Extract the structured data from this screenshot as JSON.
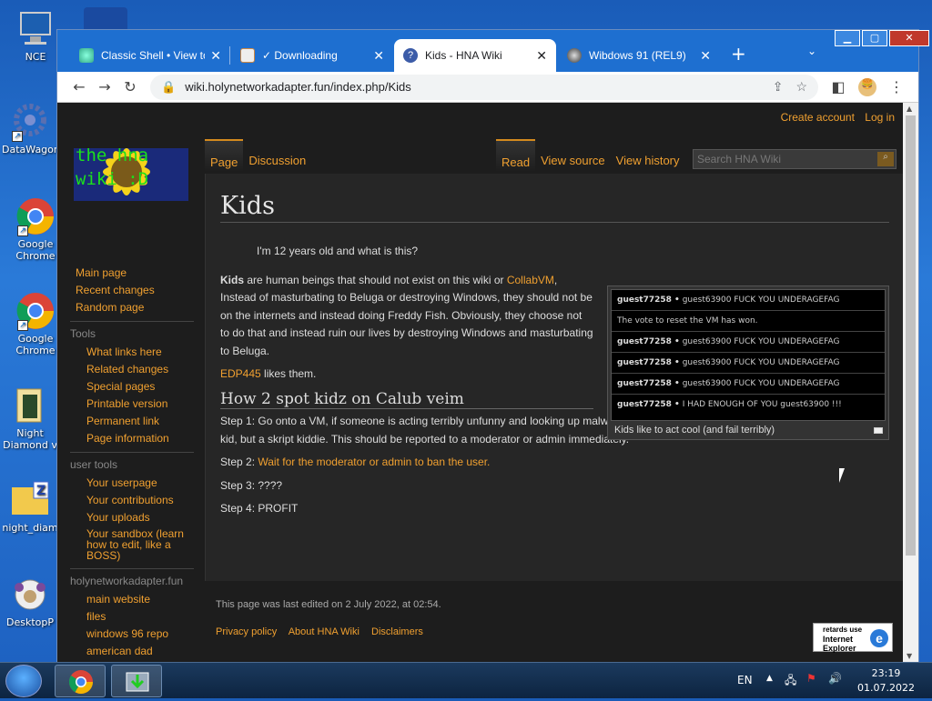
{
  "desktop": {
    "icons": [
      {
        "label": "NCE"
      },
      {
        "label": "DataWagon"
      },
      {
        "label": "Google Chrome"
      },
      {
        "label": "Google Chrome"
      },
      {
        "label": "Night Diamond v"
      },
      {
        "label": "night_diam"
      },
      {
        "label": "DesktopP"
      }
    ]
  },
  "browser": {
    "tabs": [
      {
        "label": "Classic Shell • View to",
        "icon": "globe-icon",
        "active": false
      },
      {
        "label": "✓ Downloading",
        "icon": "page-icon",
        "active": false
      },
      {
        "label": "Kids - HNA Wiki",
        "icon": "question-icon",
        "active": true
      },
      {
        "label": "Wibdows 91 (REL9)",
        "icon": "bug-icon",
        "active": false
      }
    ],
    "close_glyph": "✕",
    "new_tab_glyph": "+",
    "url": "wiki.holynetworkadapter.fun/index.php/Kids"
  },
  "wiki": {
    "personal": {
      "create_account": "Create account",
      "log_in": "Log in"
    },
    "logo_text_line1": "the hna",
    "logo_text_line2": "wiki :D",
    "page_tabs": {
      "page": "Page",
      "discussion": "Discussion",
      "read": "Read",
      "view_source": "View source",
      "view_history": "View history"
    },
    "search_placeholder": "Search HNA Wiki",
    "nav": {
      "main_page": "Main page",
      "recent_changes": "Recent changes",
      "random_page": "Random page"
    },
    "tools": {
      "heading": "Tools",
      "items": [
        "What links here",
        "Related changes",
        "Special pages",
        "Printable version",
        "Permanent link",
        "Page information"
      ]
    },
    "user_tools": {
      "heading": "user tools",
      "items": [
        "Your userpage",
        "Your contributions",
        "Your uploads",
        "Your sandbox (learn how to edit, like a BOSS)"
      ]
    },
    "hna": {
      "heading": "holynetworkadapter.fun",
      "items": [
        "main website",
        "files",
        "windows 96 repo",
        "american dad"
      ]
    },
    "title": "Kids",
    "quote": "I'm 12 years old and what is this?",
    "intro_bold": "Kids",
    "intro_1": " are human beings that should not exist on this wiki or ",
    "intro_link": "CollabVM",
    "intro_2": ", Instead of masturbating to Beluga or destroying Windows, they should not be on the internets and instead doing Freddy Fish. Obviously, they choose not to do that and instead ruin our lives by destroying Windows and masturbating to Beluga.",
    "edp_link": "EDP445",
    "edp_text": " likes them.",
    "section_title": "How 2 spot kidz on Calub veim",
    "step1": "Step 1: Go onto a VM, if someone is acting terribly unfunny and looking up malware databases, chances are they are not just a kid, but a skript kiddie. This should be reported to a moderator or admin immediately.",
    "step2_prefix": "Step 2: ",
    "step2_link": "Wait for the moderator or admin to ban the user.",
    "step3": "Step 3: ????",
    "step4": "Step 4: PROFIT",
    "chat": [
      {
        "user": "guest77258 •",
        "msg": "guest63900 FUCK YOU UNDERAGEFAG"
      },
      {
        "user": "",
        "msg": "The vote to reset the VM has won."
      },
      {
        "user": "guest77258 •",
        "msg": "guest63900 FUCK YOU UNDERAGEFAG"
      },
      {
        "user": "guest77258 •",
        "msg": "guest63900 FUCK YOU UNDERAGEFAG"
      },
      {
        "user": "guest77258 •",
        "msg": "guest63900 FUCK YOU UNDERAGEFAG"
      },
      {
        "user": "guest77258 •",
        "msg": "I HAD ENOUGH OF YOU guest63900 !!!"
      }
    ],
    "caption": "Kids like to act cool (and fail terribly)",
    "last_edited": "This page was last edited on 2 July 2022, at 02:54.",
    "footer_links": [
      "Privacy policy",
      "About HNA Wiki",
      "Disclaimers"
    ],
    "badge_line1": "retards use",
    "badge_line2": "Internet",
    "badge_line3": "Explorer"
  },
  "taskbar": {
    "lang": "EN",
    "time": "23:19",
    "date": "01.07.2022"
  }
}
